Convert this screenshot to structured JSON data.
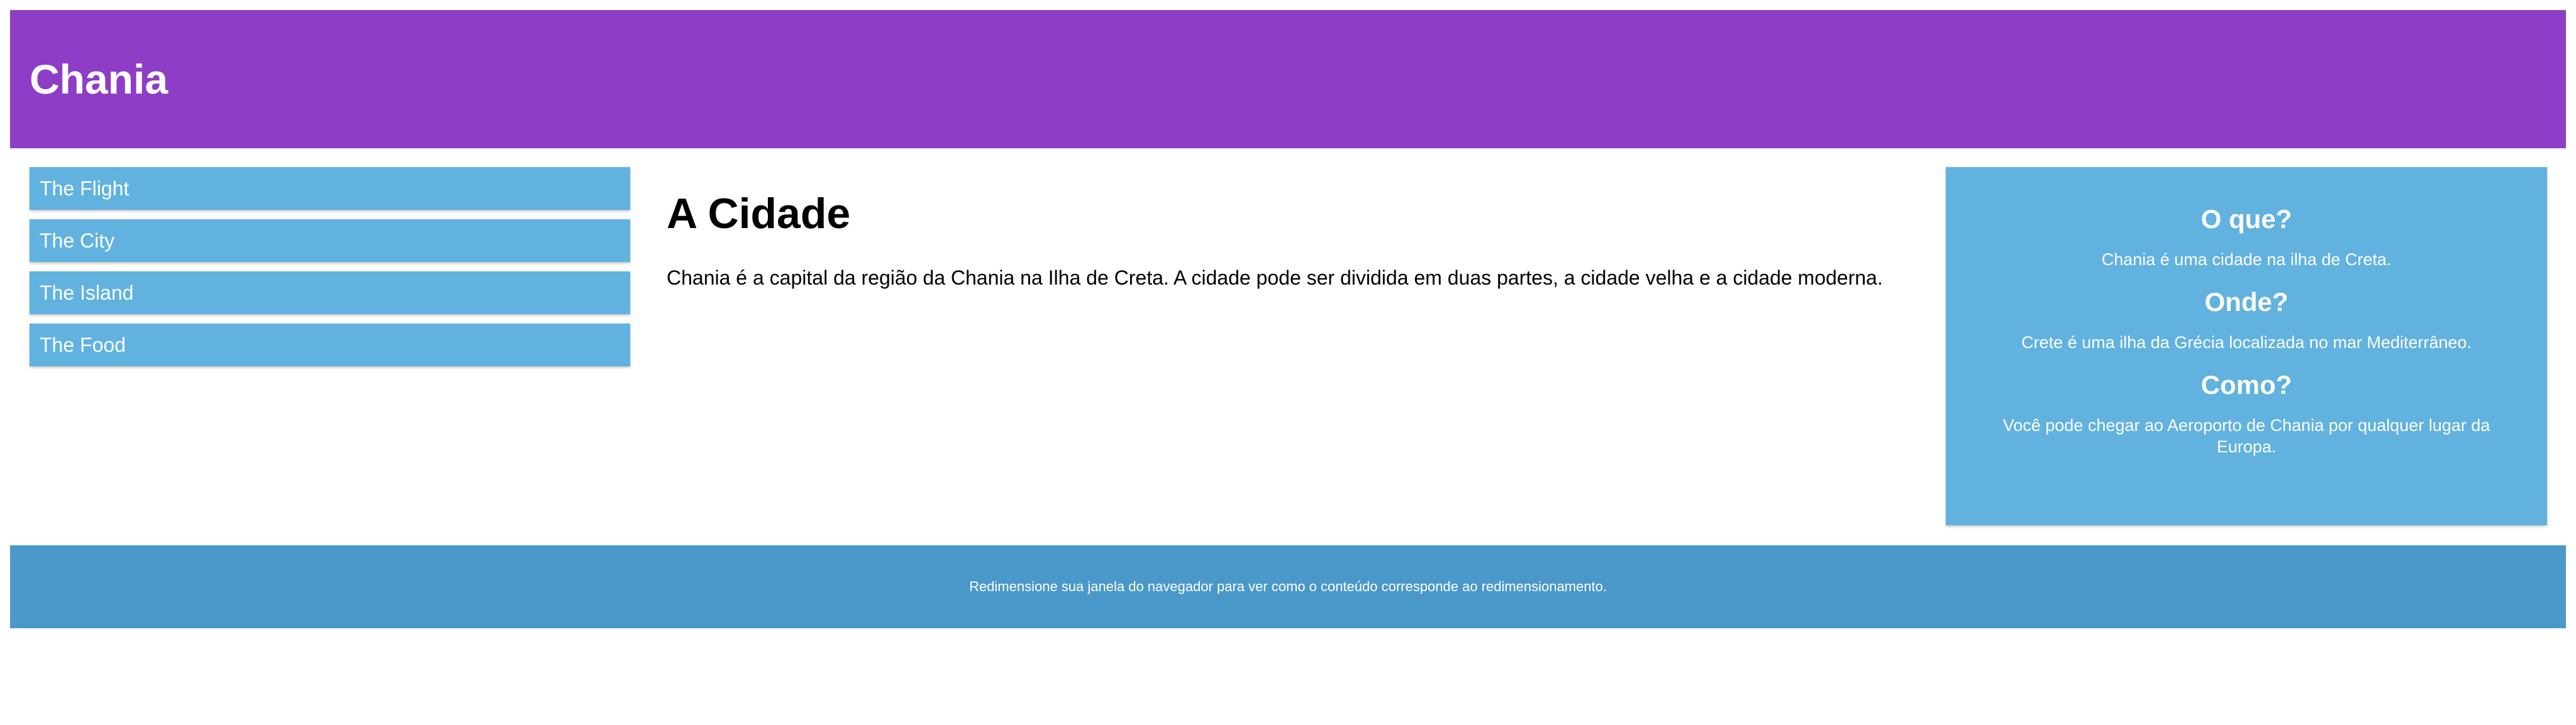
{
  "header": {
    "title": "Chania"
  },
  "menu": {
    "items": [
      {
        "label": "The Flight"
      },
      {
        "label": "The City"
      },
      {
        "label": "The Island"
      },
      {
        "label": "The Food"
      }
    ]
  },
  "main": {
    "heading": "A Cidade",
    "paragraph": "Chania é a capital da região da Chania na Ilha de Creta. A cidade pode ser dividida em duas partes, a cidade velha e a cidade moderna."
  },
  "aside": {
    "sections": [
      {
        "heading": "O que?",
        "text": "Chania é uma cidade na ilha de Creta."
      },
      {
        "heading": "Onde?",
        "text": "Crete é uma ilha da Grécia localizada no mar Mediterrâneo."
      },
      {
        "heading": "Como?",
        "text": "Você pode chegar ao Aeroporto de Chania por qualquer lugar da Europa."
      }
    ]
  },
  "footer": {
    "text": "Redimensione sua janela do navegador para ver como o conteúdo corresponde ao redimensionamento."
  },
  "colors": {
    "header_bg": "#8e3dc6",
    "menu_item_bg": "#62b2e0",
    "aside_bg": "#62b2e0",
    "footer_bg": "#4a98c9"
  }
}
